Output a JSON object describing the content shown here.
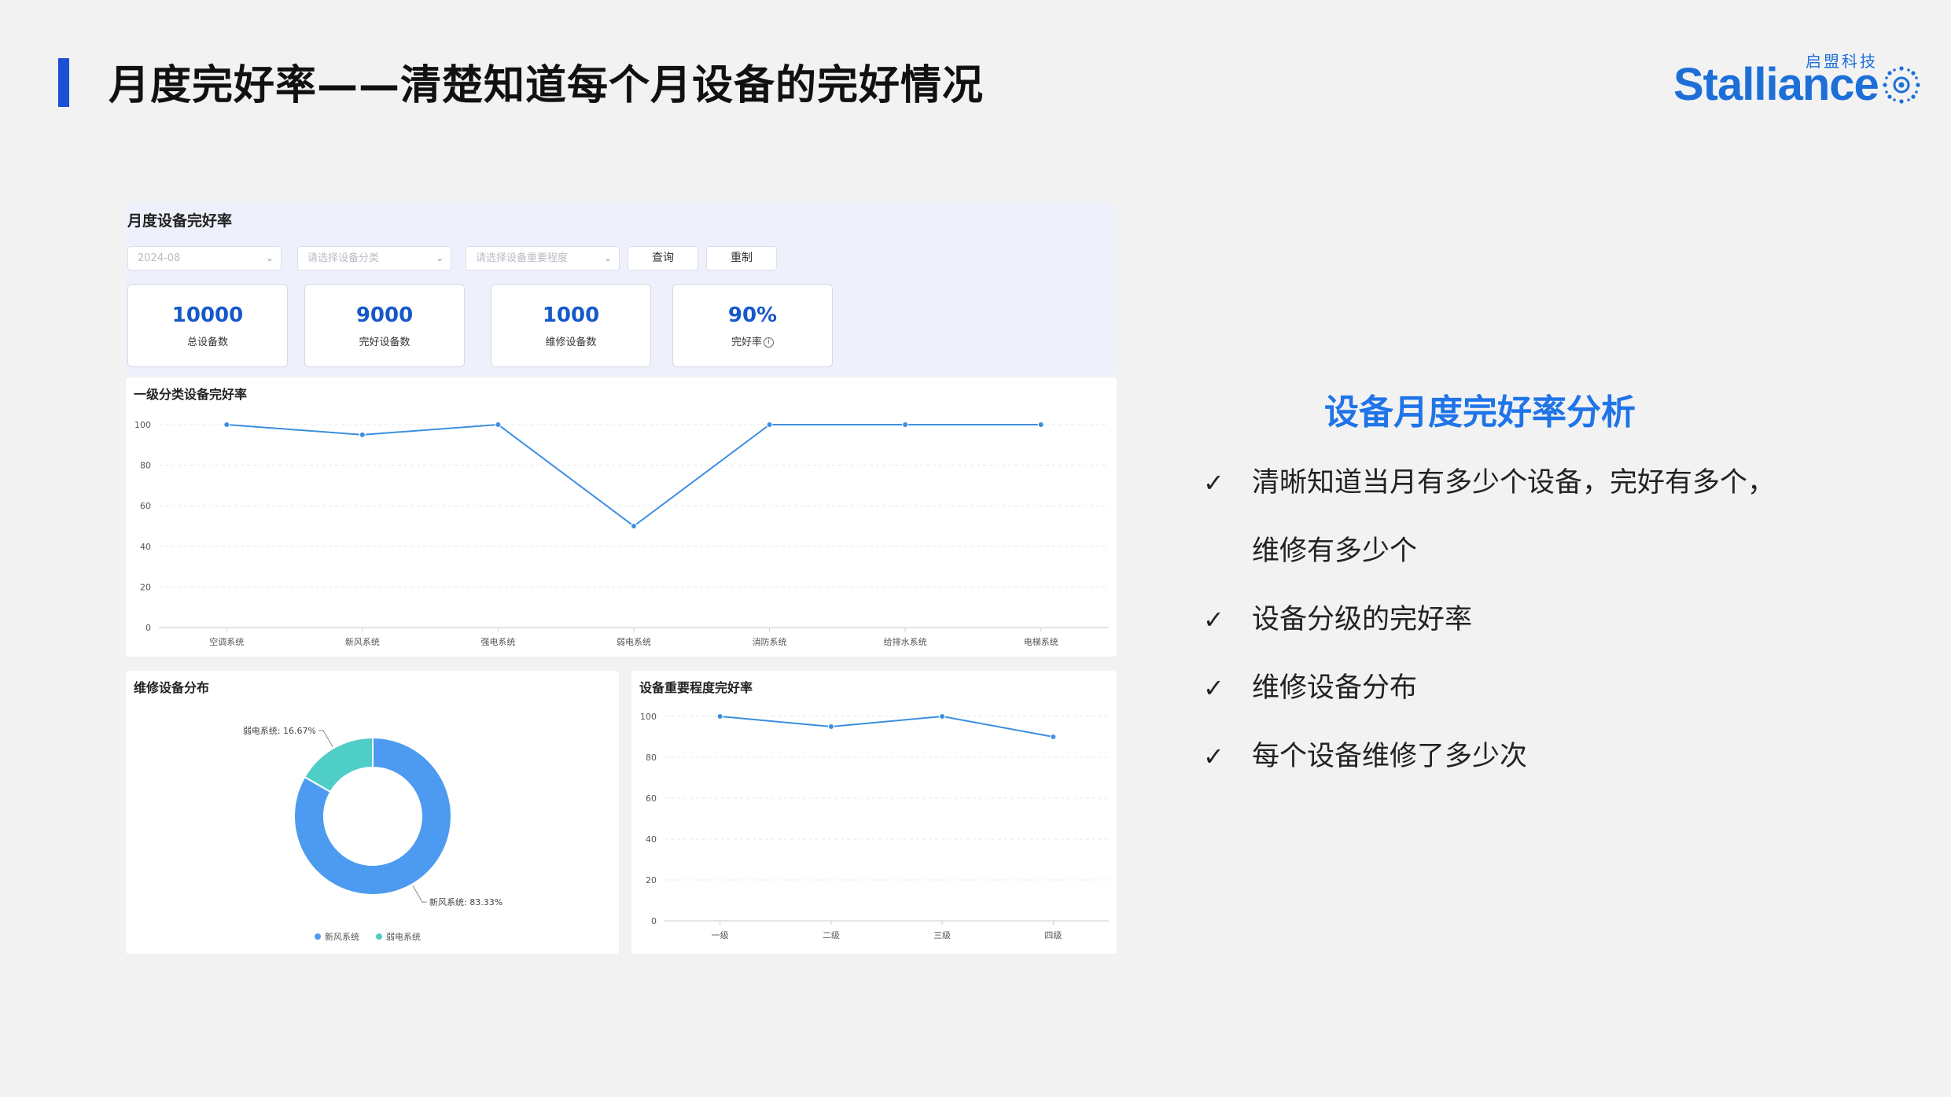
{
  "slide": {
    "title": "月度完好率——清楚知道每个月设备的完好情况",
    "logo": {
      "text": "Stalliance",
      "chinese": "启盟科技"
    }
  },
  "dashboard": {
    "title": "月度设备完好率",
    "filters": {
      "month": "2024-08",
      "category_placeholder": "请选择设备分类",
      "importance_placeholder": "请选择设备重要程度"
    },
    "buttons": {
      "query": "查询",
      "reset": "重制"
    },
    "stats": [
      {
        "value": "10000",
        "label": "总设备数"
      },
      {
        "value": "9000",
        "label": "完好设备数"
      },
      {
        "value": "1000",
        "label": "维修设备数"
      },
      {
        "value": "90%",
        "label": "完好率"
      }
    ],
    "info_icon": "i"
  },
  "chart_data": [
    {
      "type": "line",
      "title": "一级分类设备完好率",
      "categories": [
        "空调系统",
        "新风系统",
        "强电系统",
        "弱电系统",
        "消防系统",
        "给排水系统",
        "电梯系统"
      ],
      "values": [
        100,
        95,
        100,
        50,
        100,
        100,
        100
      ],
      "ylim": [
        0,
        100
      ],
      "yticks": [
        0,
        20,
        40,
        60,
        80,
        100
      ],
      "grid": true,
      "color": "#3c8fdf"
    },
    {
      "type": "pie",
      "title": "维修设备分布",
      "slices": [
        {
          "name": "新风系统",
          "value": 83.33,
          "label": "新风系统: 83.33%",
          "color": "#4d9bf0"
        },
        {
          "name": "弱电系统",
          "value": 16.67,
          "label": "弱电系统: 16.67%",
          "color": "#4fcdc7"
        }
      ],
      "legend": "bottom"
    },
    {
      "type": "line",
      "title": "设备重要程度完好率",
      "categories": [
        "一级",
        "二级",
        "三级",
        "四级"
      ],
      "values": [
        100,
        95,
        100,
        90
      ],
      "ylim": [
        0,
        100
      ],
      "yticks": [
        0,
        20,
        40,
        60,
        80,
        100
      ],
      "grid": true,
      "color": "#3c8fdf"
    }
  ],
  "analysis": {
    "title": "设备月度完好率分析",
    "check_glyph": "✓",
    "bullets": [
      {
        "line1": "清晰知道当月有多少个设备，完好有多个，",
        "line2": "维修有多少个"
      },
      {
        "line1": "设备分级的完好率"
      },
      {
        "line1": "维修设备分布"
      },
      {
        "line1": "每个设备维修了多少次"
      }
    ]
  }
}
